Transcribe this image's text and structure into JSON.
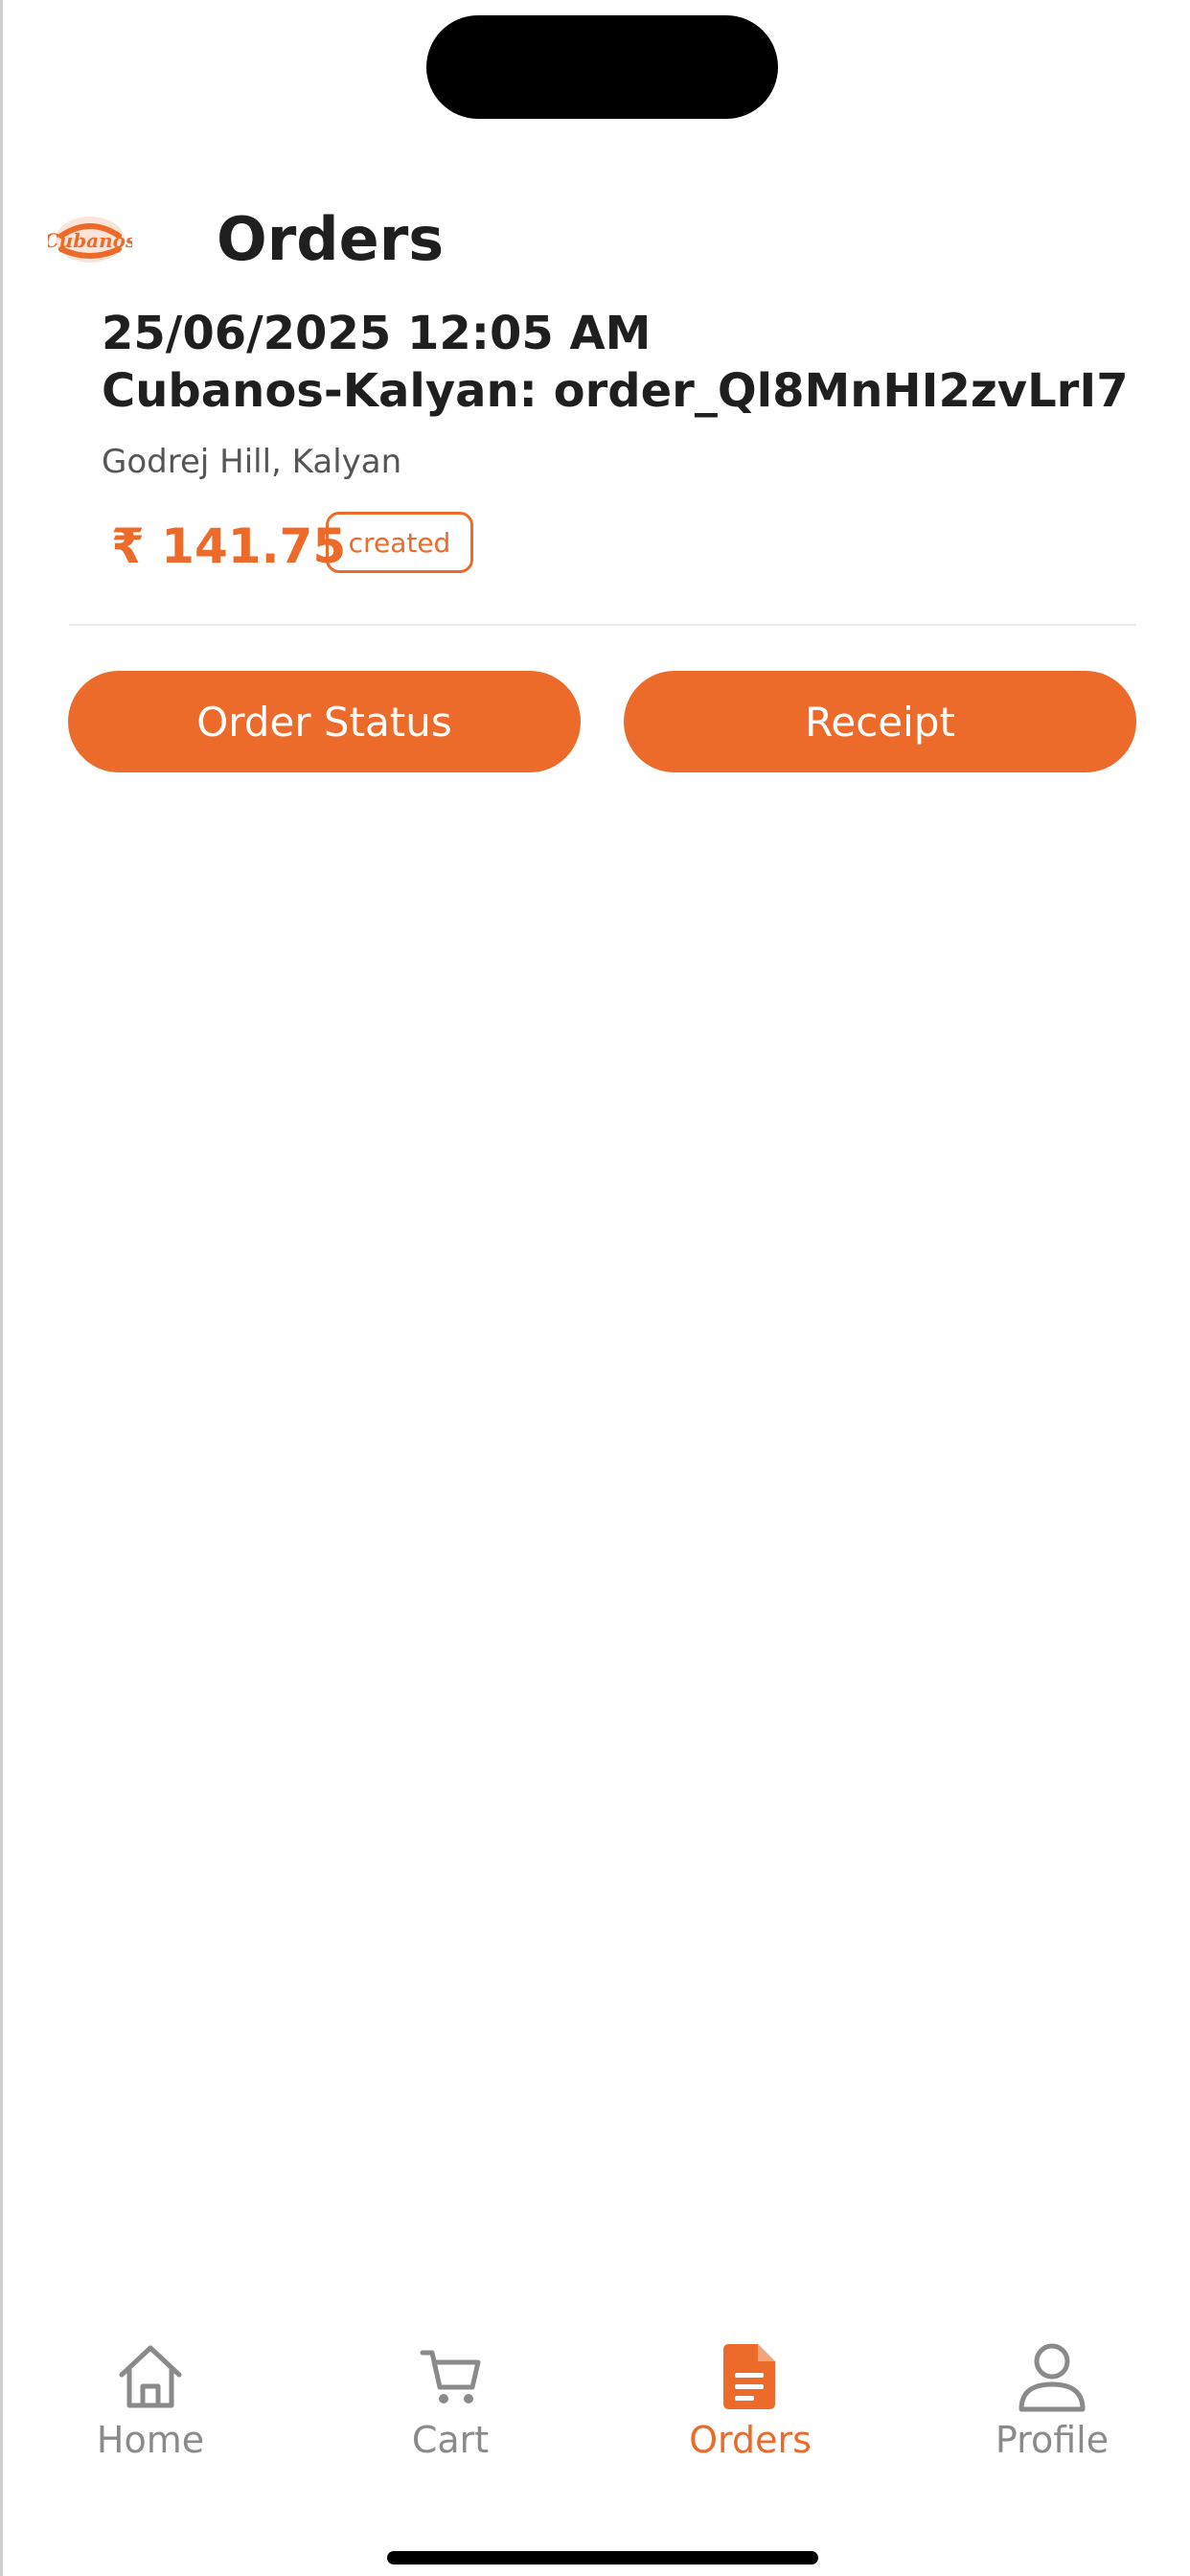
{
  "header": {
    "title": "Orders",
    "logo_icon": "cubanos-logo",
    "logo_text": "Cubanos"
  },
  "order": {
    "datetime": "25/06/2025 12:05 AM",
    "name": "Cubanos-Kalyan: order_Ql8MnHI2zvLrI7",
    "location": "Godrej Hill, Kalyan",
    "price": "₹ 141.75",
    "status": "created"
  },
  "actions": {
    "order_status_label": "Order Status",
    "receipt_label": "Receipt"
  },
  "tabbar": {
    "items": [
      {
        "label": "Home",
        "icon": "home-icon",
        "active": false
      },
      {
        "label": "Cart",
        "icon": "cart-icon",
        "active": false
      },
      {
        "label": "Orders",
        "icon": "orders-icon",
        "active": true
      },
      {
        "label": "Profile",
        "icon": "profile-icon",
        "active": false
      }
    ]
  },
  "colors": {
    "accent": "#ec6a2a",
    "text": "#1f1f1f",
    "muted": "#8a8a8a"
  }
}
